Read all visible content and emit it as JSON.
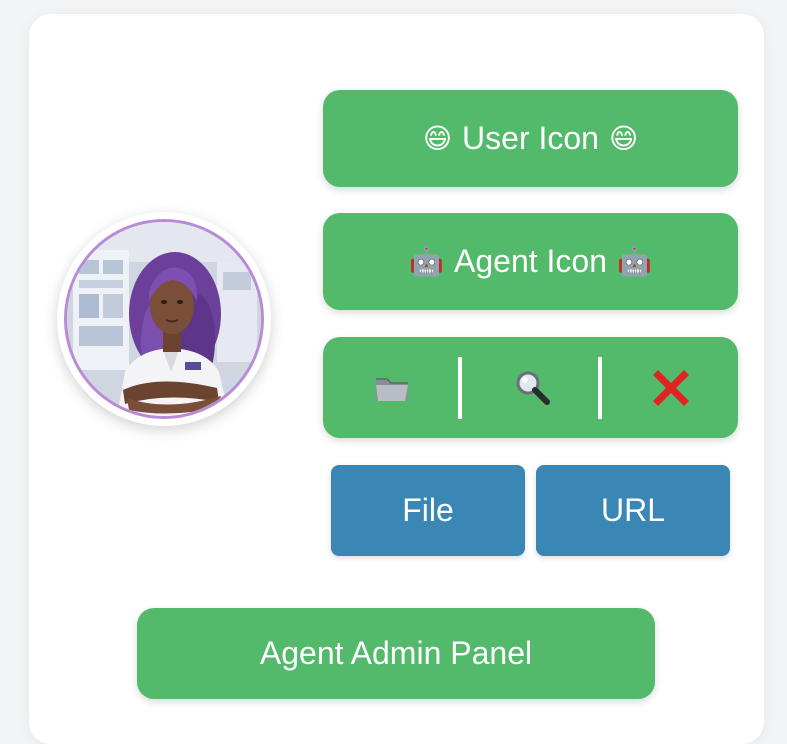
{
  "avatar": {
    "ring_color": "#b98ad6"
  },
  "user_icon_button": {
    "emoji_left": "😄",
    "label": "User Icon",
    "emoji_right": "😄"
  },
  "agent_icon_button": {
    "emoji_left": "🤖",
    "label": "Agent Icon",
    "emoji_right": "🤖"
  },
  "toolbar": {
    "items": [
      {
        "icon": "folder-icon"
      },
      {
        "icon": "magnifier-icon"
      },
      {
        "icon": "close-x-icon",
        "color": "#e02424"
      }
    ]
  },
  "upload_buttons": {
    "file_label": "File",
    "url_label": "URL"
  },
  "admin_button": {
    "label": "Agent Admin Panel"
  },
  "colors": {
    "green": "#53b96b",
    "blue": "#3a87b6"
  }
}
